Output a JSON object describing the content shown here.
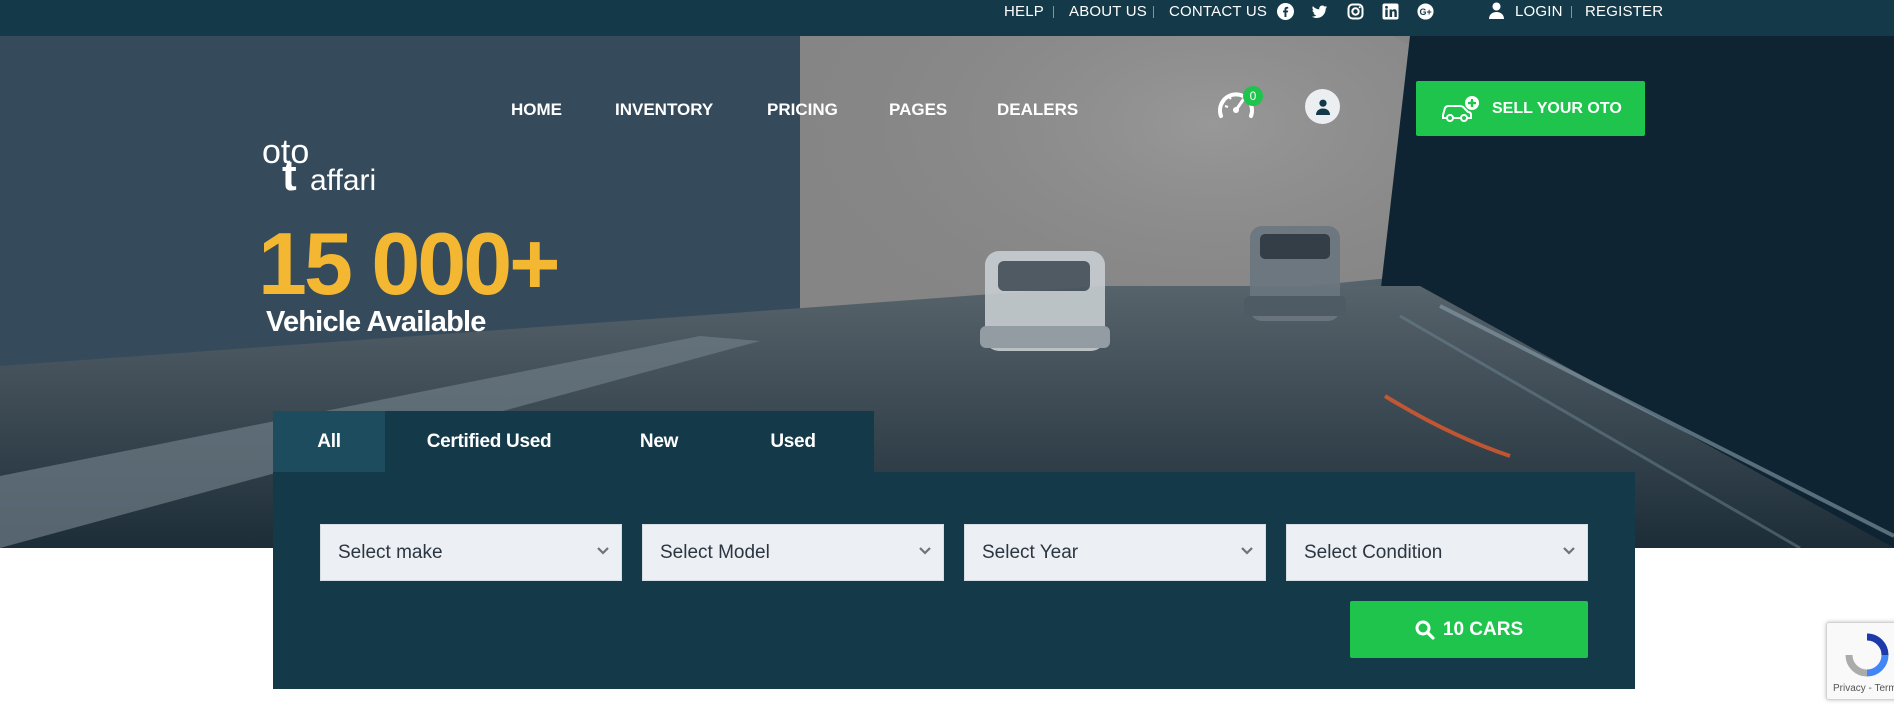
{
  "topbar": {
    "links": [
      "HELP",
      "ABOUT US",
      "CONTACT US"
    ],
    "social_icons": [
      "facebook-icon",
      "twitter-icon",
      "instagram-icon",
      "linkedin-icon",
      "google-plus-icon"
    ],
    "login": "LOGIN",
    "register": "REGISTER"
  },
  "brand": {
    "name_top": "oto",
    "name_bottom": "affari",
    "letter": "t"
  },
  "nav": [
    "HOME",
    "INVENTORY",
    "PRICING",
    "PAGES",
    "DEALERS"
  ],
  "compare_count": "0",
  "sell_button": "SELL YOUR OTO",
  "hero": {
    "count": "15 000+",
    "subtitle": "Vehicle Available"
  },
  "tabs": [
    "All",
    "Certified Used",
    "New",
    "Used"
  ],
  "filters": {
    "make": "Select make",
    "model": "Select Model",
    "year": "Select Year",
    "condition": "Select Condition"
  },
  "search_button": "10 CARS",
  "recaptcha": "Privacy - Terms",
  "colors": {
    "dark": "#143a49",
    "green": "#1fc44d",
    "accent_yellow": "#f4b731",
    "field": "#eceff3"
  }
}
